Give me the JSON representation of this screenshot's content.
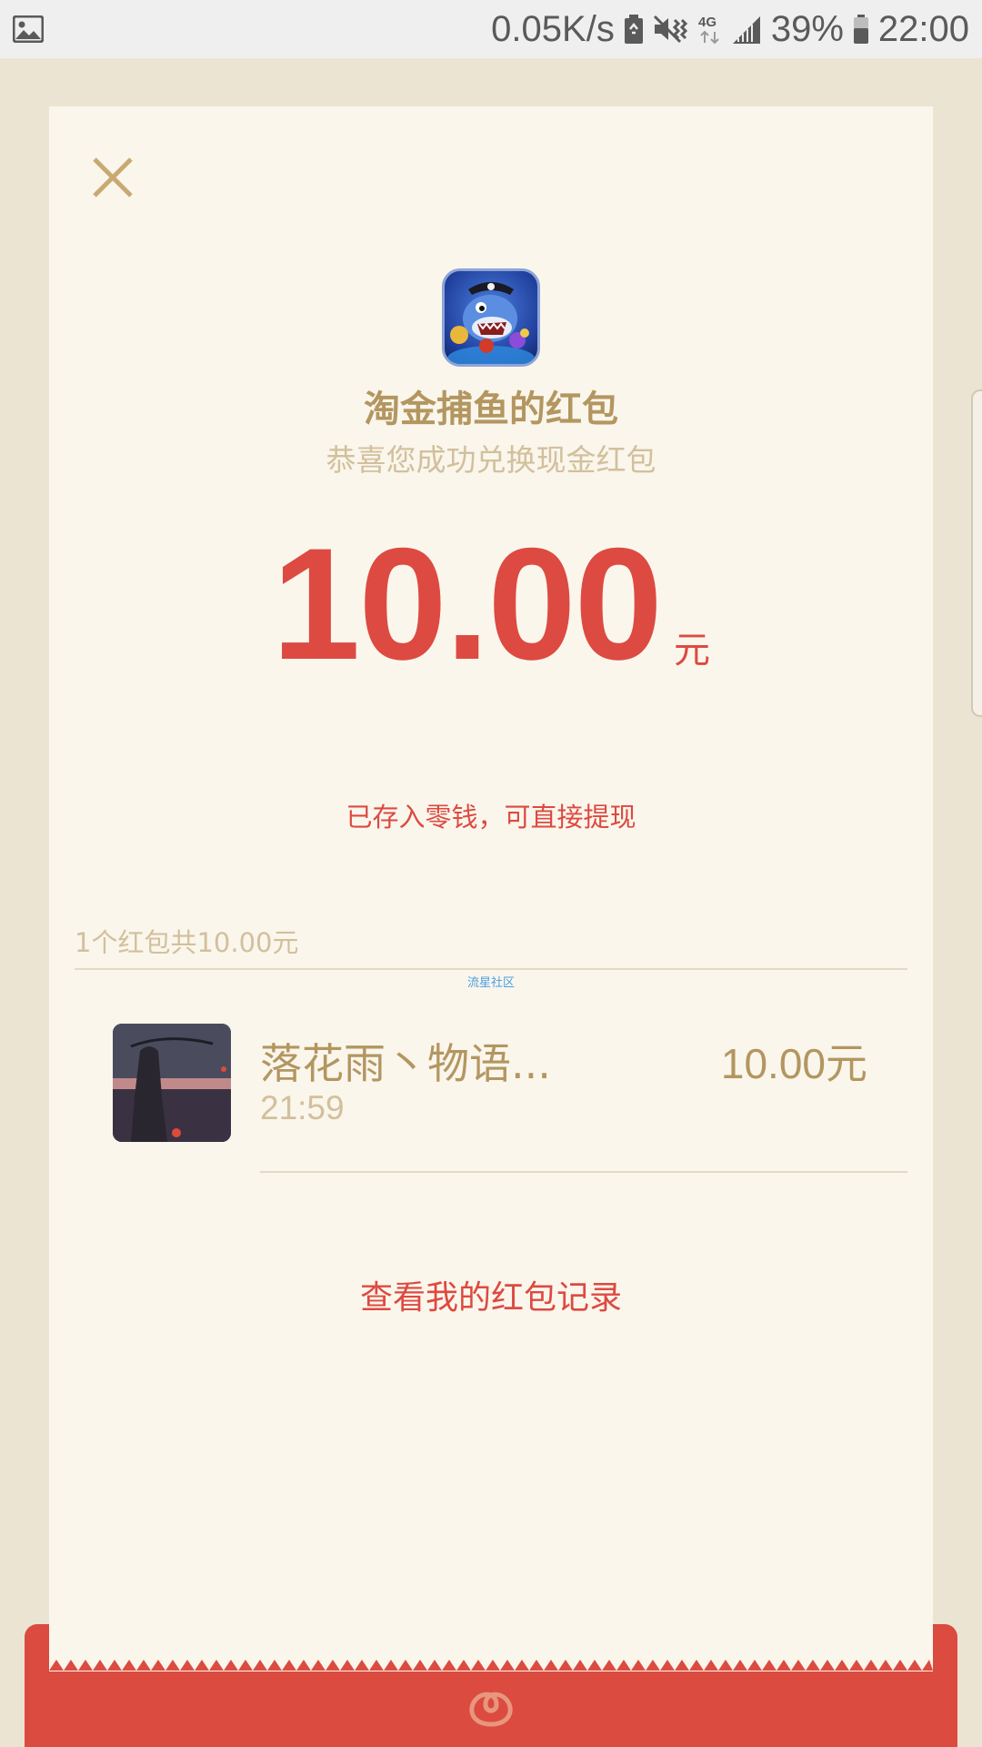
{
  "status_bar": {
    "network_speed": "0.05K/s",
    "network_type": "4G",
    "battery_percent": "39%",
    "time": "22:00",
    "icons": [
      "gallery-icon",
      "battery-saver-icon",
      "mute-vibrate-icon",
      "network-4g-icon",
      "signal-icon",
      "battery-icon"
    ]
  },
  "card": {
    "close_icon": "close-icon",
    "app_icon": "shark-game-icon",
    "sender_title": "淘金捕鱼的红包",
    "subtitle": "恭喜您成功兑换现金红包",
    "amount": "10.00",
    "amount_unit": "元",
    "stored_note": "已存入零钱，可直接提现",
    "summary": "1个红包共10.00元",
    "watermark": "流星社区",
    "record": {
      "name": "落花雨丶物语...",
      "time": "21:59",
      "amount": "10.00元"
    },
    "history_link": "查看我的红包记录"
  },
  "colors": {
    "background": "#ECE4D3",
    "card": "#FAF6EC",
    "accent_red": "#DD4A41",
    "gold_text": "#B39660",
    "light_gold_text": "#D2C09C",
    "envelope_red": "#DB4B40"
  }
}
